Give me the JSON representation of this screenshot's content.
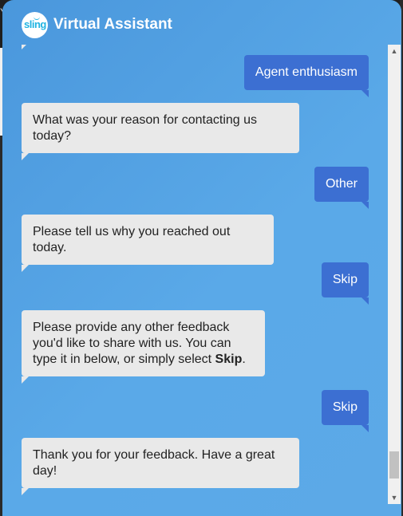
{
  "header": {
    "logo_text": "sling",
    "title": "Virtual Assistant"
  },
  "messages": [
    {
      "sender": "user",
      "text": "Agent enthusiasm"
    },
    {
      "sender": "bot",
      "text": "What was your reason for contacting us today?"
    },
    {
      "sender": "user",
      "text": "Other"
    },
    {
      "sender": "bot",
      "text": "Please tell us why you reached out today."
    },
    {
      "sender": "user",
      "text": "Skip"
    },
    {
      "sender": "bot",
      "text_before": "Please provide any other feedback you'd like to share with us. You can type it in below, or simply select ",
      "text_bold": "Skip",
      "text_after": "."
    },
    {
      "sender": "user",
      "text": "Skip"
    },
    {
      "sender": "bot",
      "text": "Thank you for your feedback. Have a great day!"
    }
  ],
  "scrollbar": {
    "up_arrow_icon": "chevron-up-icon",
    "down_arrow_icon": "chevron-down-icon"
  },
  "colors": {
    "header_bg": "#4a97dc",
    "user_bubble": "#3c6fd2",
    "bot_bubble": "#e9e9e9",
    "logo_accent": "#21b4e2"
  }
}
